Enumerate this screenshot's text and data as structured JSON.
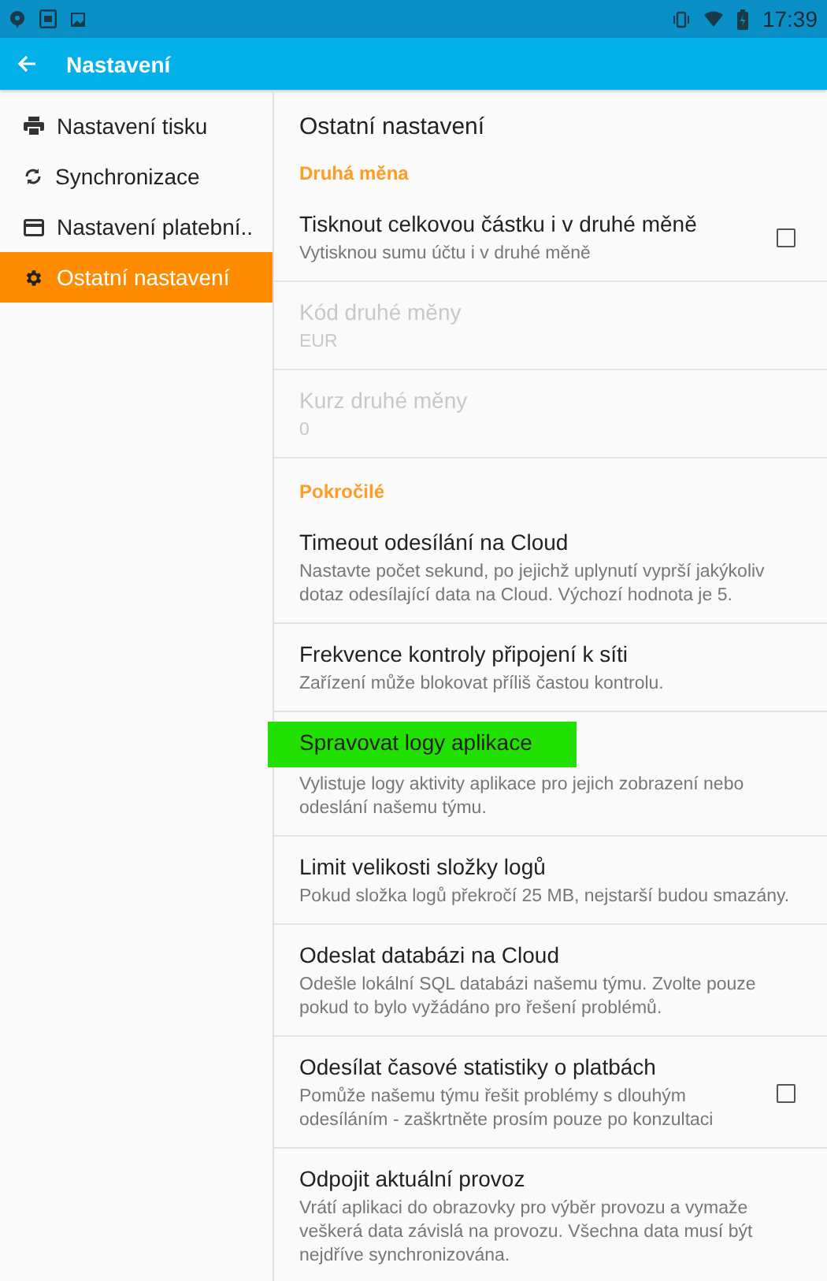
{
  "status_bar": {
    "time": "17:39"
  },
  "app_bar": {
    "title": "Nastavení"
  },
  "sidebar": {
    "items": [
      {
        "label": "Nastavení tisku",
        "selected": false
      },
      {
        "label": "Synchronizace",
        "selected": false
      },
      {
        "label": "Nastavení platební..",
        "selected": false
      },
      {
        "label": "Ostatní nastavení",
        "selected": true
      }
    ]
  },
  "content": {
    "title": "Ostatní nastavení",
    "items": [
      {
        "kind": "category",
        "title": "Druhá měna"
      },
      {
        "kind": "checkbox",
        "title": "Tisknout celkovou částku i v druhé měně",
        "summary": "Vytisknou sumu účtu i v druhé měně",
        "checked": false,
        "disabled": false,
        "highlighted": false
      },
      {
        "kind": "text",
        "title": "Kód druhé měny",
        "summary": "EUR",
        "disabled": true,
        "highlighted": false
      },
      {
        "kind": "text",
        "title": "Kurz druhé měny",
        "summary": "0",
        "disabled": true,
        "highlighted": false
      },
      {
        "kind": "category",
        "title": "Pokročilé"
      },
      {
        "kind": "text",
        "title": "Timeout odesílání na Cloud",
        "summary": "Nastavte počet sekund, po jejichž uplynutí vyprší jakýkoliv dotaz odesílající data na Cloud. Výchozí hodnota je 5.",
        "disabled": false,
        "highlighted": false
      },
      {
        "kind": "text",
        "title": "Frekvence kontroly připojení k síti",
        "summary": "Zařízení může blokovat příliš častou kontrolu.",
        "disabled": false,
        "highlighted": false
      },
      {
        "kind": "text",
        "title": "Spravovat logy aplikace",
        "summary": "Vylistuje logy aktivity aplikace pro jejich zobrazení nebo odeslání našemu týmu.",
        "disabled": false,
        "highlighted": true
      },
      {
        "kind": "text",
        "title": "Limit velikosti složky logů",
        "summary": "Pokud složka logů překročí 25 MB, nejstarší budou smazány.",
        "disabled": false,
        "highlighted": false
      },
      {
        "kind": "text",
        "title": "Odeslat databázi na Cloud",
        "summary": "Odešle lokální SQL databázi našemu týmu. Zvolte pouze pokud to bylo vyžádáno pro řešení problémů.",
        "disabled": false,
        "highlighted": false
      },
      {
        "kind": "checkbox",
        "title": "Odesílat časové statistiky o platbách",
        "summary": "Pomůže našemu týmu řešit problémy s dlouhým odesíláním - zaškrtněte prosím pouze po konzultaci",
        "checked": false,
        "disabled": false,
        "highlighted": false
      },
      {
        "kind": "text",
        "title": "Odpojit aktuální provoz",
        "summary": "Vrátí aplikaci do obrazovky pro výběr provozu a vymaže veškerá data závislá na provozu. Všechna data musí být nejdříve synchronizována.",
        "disabled": false,
        "highlighted": false
      }
    ]
  }
}
